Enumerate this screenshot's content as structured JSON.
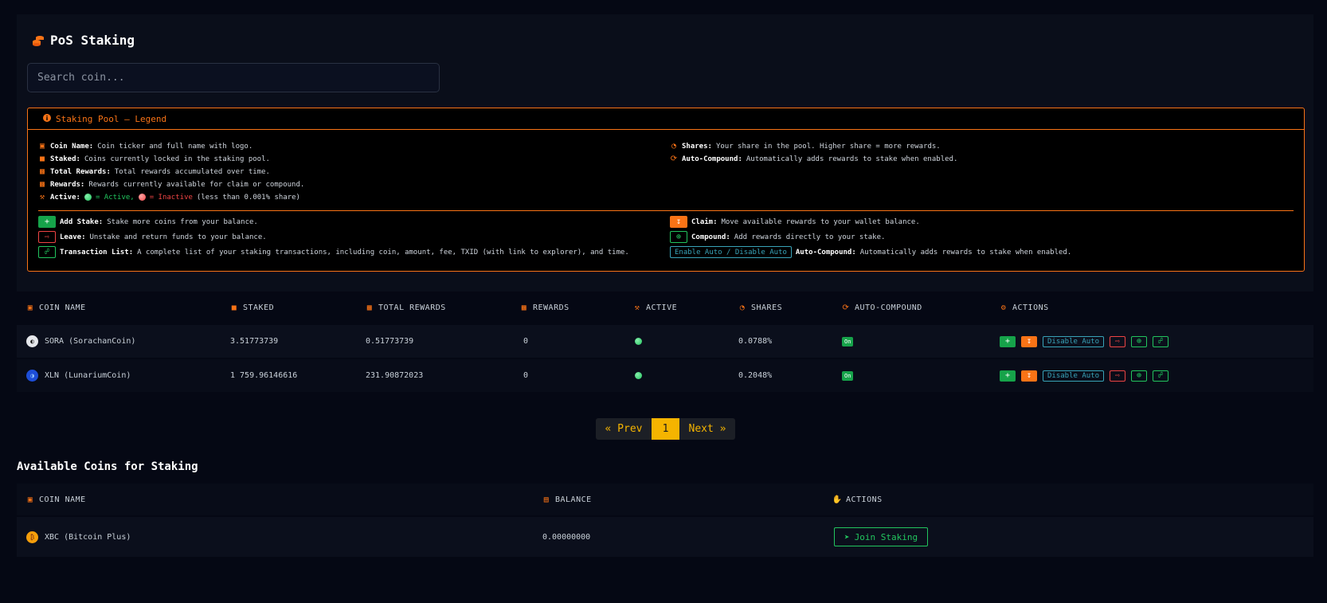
{
  "page": {
    "title": "PoS Staking"
  },
  "search": {
    "placeholder": "Search coin..."
  },
  "legend": {
    "title": "Staking Pool – Legend",
    "left_items": [
      {
        "label": "Coin Name:",
        "text": "Coin ticker and full name with logo."
      },
      {
        "label": "Staked:",
        "text": "Coins currently locked in the staking pool."
      },
      {
        "label": "Total Rewards:",
        "text": "Total rewards accumulated over time."
      },
      {
        "label": "Rewards:",
        "text": "Rewards currently available for claim or compound."
      }
    ],
    "active": {
      "label": "Active:",
      "active_text": "= Active,",
      "inactive_text": "= Inactive",
      "note": "(less than 0.001% share)"
    },
    "right_items": [
      {
        "label": "Shares:",
        "text": "Your share in the pool. Higher share = more rewards."
      },
      {
        "label": "Auto-Compound:",
        "text": "Automatically adds rewards to stake when enabled."
      }
    ],
    "actions_left": [
      {
        "label": "Add Stake:",
        "text": "Stake more coins from your balance."
      },
      {
        "label": "Leave:",
        "text": "Unstake and return funds to your balance."
      },
      {
        "label": "Transaction List:",
        "text": "A complete list of your staking transactions, including coin, amount, fee, TXID (with link to explorer), and time."
      }
    ],
    "actions_right": [
      {
        "label": "Claim:",
        "text": "Move available rewards to your wallet balance."
      },
      {
        "label": "Compound:",
        "text": "Add rewards directly to your stake."
      },
      {
        "button": "Enable Auto / Disable Auto",
        "label": "Auto-Compound:",
        "text": "Automatically adds rewards to stake when enabled."
      }
    ]
  },
  "staking_table": {
    "headers": [
      "COIN NAME",
      "STAKED",
      "TOTAL REWARDS",
      "REWARDS",
      "ACTIVE",
      "SHARES",
      "AUTO-COMPOUND",
      "ACTIONS"
    ],
    "rows": [
      {
        "coin": "SORA (SorachanCoin)",
        "staked": "3.51773739",
        "total_rewards": "0.51773739",
        "rewards": "0",
        "active": true,
        "shares": "0.0788%",
        "auto": "On",
        "auto_btn": "Disable Auto"
      },
      {
        "coin": "XLN (LunariumCoin)",
        "staked": "1 759.96146616",
        "total_rewards": "231.90872023",
        "rewards": "0",
        "active": true,
        "shares": "0.2048%",
        "auto": "On",
        "auto_btn": "Disable Auto"
      }
    ]
  },
  "pagination": {
    "prev": "« Prev",
    "current": "1",
    "next": "Next »"
  },
  "available": {
    "title": "Available Coins for Staking",
    "headers": [
      "COIN NAME",
      "BALANCE",
      "ACTIONS"
    ],
    "rows": [
      {
        "coin": "XBC (Bitcoin Plus)",
        "balance": "0.00000000",
        "action": "Join Staking"
      }
    ]
  },
  "colors": {
    "accent": "#f97316",
    "green": "#22c55e",
    "red": "#ef4444",
    "gold": "#f5b400",
    "cyan": "#38a3b8"
  },
  "icons": [
    "coins-icon",
    "info-icon",
    "layers-icon",
    "gift-icon",
    "hammer-icon",
    "pie-icon",
    "sync-icon",
    "gears-icon",
    "wallet-icon",
    "hand-icon"
  ]
}
